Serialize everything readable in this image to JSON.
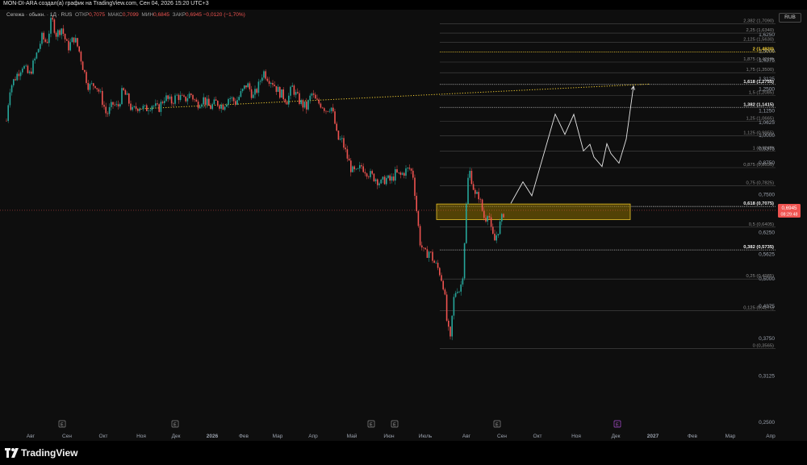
{
  "header": {
    "text": "MON-DI-ARA создал(а) график на TradingView.com, Сен 04, 2026 15:20 UTC+3"
  },
  "legend": {
    "symbol": "Сегежа · обыкн. · 1Д · RUS",
    "open_label": "ОТКР",
    "open_value": "0,7075",
    "high_label": "МАКС",
    "high_value": "0,7099",
    "low_label": "МИН",
    "low_value": "0,6845",
    "close_label": "ЗАКР",
    "close_value": "0,6945 −0,0120 (−1,70%)"
  },
  "currency": "RUB",
  "footer": {
    "brand": "TradingView"
  },
  "colors": {
    "up": "#26a69a",
    "down": "#ef5350",
    "fib_gold": "#f5d033",
    "zone_fill": "#8a6d00",
    "zone_border": "#e8c22a",
    "price_tag": "#ef5350"
  },
  "chart_data": {
    "type": "candlestick",
    "y_scale": "log",
    "ylim": [
      0.24,
      1.83
    ],
    "y_ticks": [
      {
        "value": 1.625,
        "label": "1,6250"
      },
      {
        "value": 1.5,
        "label": "1,5000"
      },
      {
        "value": 1.4375,
        "label": "1,4375"
      },
      {
        "value": 1.3125,
        "label": "1,3125"
      },
      {
        "value": 1.25,
        "label": "1,2500"
      },
      {
        "value": 1.125,
        "label": "1,1250"
      },
      {
        "value": 1.0625,
        "label": "1,0625"
      },
      {
        "value": 1.0,
        "label": "1,0000"
      },
      {
        "value": 0.9375,
        "label": "0,9375"
      },
      {
        "value": 0.875,
        "label": "0,8750"
      },
      {
        "value": 0.75,
        "label": "0,7500"
      },
      {
        "value": 0.625,
        "label": "0,6250"
      },
      {
        "value": 0.5625,
        "label": "0,5625"
      },
      {
        "value": 0.5,
        "label": "0,5000"
      },
      {
        "value": 0.4375,
        "label": "0,4375"
      },
      {
        "value": 0.375,
        "label": "0,3750"
      },
      {
        "value": 0.3125,
        "label": "0,3125"
      },
      {
        "value": 0.25,
        "label": "0,2500"
      }
    ],
    "x_ticks": [
      "Авг",
      "Сен",
      "Окт",
      "Ноя",
      "Дек",
      "2026",
      "Фев",
      "Мар",
      "Апр",
      "Май",
      "Июн",
      "Июль",
      "Авг",
      "Сен",
      "Окт",
      "Ноя",
      "Дек",
      "2027",
      "Фев",
      "Мар",
      "Апр"
    ],
    "fib_levels": [
      {
        "value": 1.709,
        "label": "2,382 (1,7090)",
        "style": "gray"
      },
      {
        "value": 1.634,
        "label": "2,25 (1,6340)",
        "style": "gray"
      },
      {
        "value": 1.563,
        "label": "2,125 (1,5630)",
        "style": "gray"
      },
      {
        "value": 1.492,
        "label": "2 (1,4920)",
        "style": "gold"
      },
      {
        "value": 1.421,
        "label": "1,875 (1,4210)",
        "style": "gray"
      },
      {
        "value": 1.35,
        "label": "1,75 (1,3500)",
        "style": "gray"
      },
      {
        "value": 1.2755,
        "label": "1,618 (1,2755)",
        "style": "white"
      },
      {
        "value": 1.2085,
        "label": "1,5 (1,2085)",
        "style": "gray"
      },
      {
        "value": 1.1415,
        "label": "1,382 (1,1415)",
        "style": "white"
      },
      {
        "value": 1.0665,
        "label": "1,25 (1,0665)",
        "style": "gray"
      },
      {
        "value": 0.9955,
        "label": "1,125 (0,9955)",
        "style": "gray"
      },
      {
        "value": 0.9245,
        "label": "1 (0,9245)",
        "style": "gray"
      },
      {
        "value": 0.8535,
        "label": "0,875 (0,8535)",
        "style": "gray"
      },
      {
        "value": 0.7825,
        "label": "0,75 (0,7825)",
        "style": "gray"
      },
      {
        "value": 0.7075,
        "label": "0,618 (0,7075)",
        "style": "white"
      },
      {
        "value": 0.6405,
        "label": "0,5 (0,6405)",
        "style": "gray"
      },
      {
        "value": 0.5735,
        "label": "0,382 (0,5735)",
        "style": "white"
      },
      {
        "value": 0.4985,
        "label": "0,25 (0,4985)",
        "style": "gray"
      },
      {
        "value": 0.4275,
        "label": "0,125 (0,4275)",
        "style": "gray"
      },
      {
        "value": 0.3565,
        "label": "0 (0,3565)",
        "style": "gray"
      }
    ],
    "last_price": "0,6945",
    "countdown": "08:29:48",
    "earnings_markers": [
      "E",
      "E",
      "E",
      "E",
      "E",
      "E"
    ],
    "zone": {
      "low": 0.664,
      "high": 0.716
    },
    "dotted_trend": [
      {
        "x": 170,
        "y": 1.133
      },
      {
        "x": 806,
        "y": 1.278
      }
    ],
    "projection": [
      {
        "x": 633,
        "y": 0.718
      },
      {
        "x": 648,
        "y": 0.797
      },
      {
        "x": 659,
        "y": 0.745
      },
      {
        "x": 688,
        "y": 1.105
      },
      {
        "x": 700,
        "y": 1.002
      },
      {
        "x": 711,
        "y": 1.104
      },
      {
        "x": 723,
        "y": 0.925
      },
      {
        "x": 731,
        "y": 0.955
      },
      {
        "x": 736,
        "y": 0.898
      },
      {
        "x": 746,
        "y": 0.858
      },
      {
        "x": 752,
        "y": 0.958
      },
      {
        "x": 757,
        "y": 0.914
      },
      {
        "x": 767,
        "y": 0.872
      },
      {
        "x": 776,
        "y": 0.98
      },
      {
        "x": 785,
        "y": 1.265
      }
    ],
    "price_path": [
      {
        "x": 8,
        "y": 1.07
      },
      {
        "x": 12,
        "y": 1.25
      },
      {
        "x": 18,
        "y": 1.31
      },
      {
        "x": 28,
        "y": 1.4
      },
      {
        "x": 36,
        "y": 1.33
      },
      {
        "x": 44,
        "y": 1.45
      },
      {
        "x": 52,
        "y": 1.6
      },
      {
        "x": 58,
        "y": 1.56
      },
      {
        "x": 64,
        "y": 1.75
      },
      {
        "x": 70,
        "y": 1.62
      },
      {
        "x": 76,
        "y": 1.68
      },
      {
        "x": 84,
        "y": 1.52
      },
      {
        "x": 92,
        "y": 1.6
      },
      {
        "x": 98,
        "y": 1.5
      },
      {
        "x": 104,
        "y": 1.36
      },
      {
        "x": 110,
        "y": 1.26
      },
      {
        "x": 118,
        "y": 1.28
      },
      {
        "x": 124,
        "y": 1.22
      },
      {
        "x": 132,
        "y": 1.1
      },
      {
        "x": 140,
        "y": 1.16
      },
      {
        "x": 146,
        "y": 1.14
      },
      {
        "x": 152,
        "y": 1.24
      },
      {
        "x": 158,
        "y": 1.19
      },
      {
        "x": 164,
        "y": 1.12
      },
      {
        "x": 172,
        "y": 1.15
      },
      {
        "x": 180,
        "y": 1.13
      },
      {
        "x": 188,
        "y": 1.16
      },
      {
        "x": 196,
        "y": 1.13
      },
      {
        "x": 204,
        "y": 1.2
      },
      {
        "x": 212,
        "y": 1.17
      },
      {
        "x": 220,
        "y": 1.21
      },
      {
        "x": 228,
        "y": 1.18
      },
      {
        "x": 236,
        "y": 1.22
      },
      {
        "x": 244,
        "y": 1.16
      },
      {
        "x": 252,
        "y": 1.19
      },
      {
        "x": 260,
        "y": 1.14
      },
      {
        "x": 268,
        "y": 1.17
      },
      {
        "x": 276,
        "y": 1.15
      },
      {
        "x": 284,
        "y": 1.2
      },
      {
        "x": 292,
        "y": 1.17
      },
      {
        "x": 300,
        "y": 1.23
      },
      {
        "x": 306,
        "y": 1.28
      },
      {
        "x": 314,
        "y": 1.2
      },
      {
        "x": 320,
        "y": 1.26
      },
      {
        "x": 326,
        "y": 1.36
      },
      {
        "x": 332,
        "y": 1.32
      },
      {
        "x": 338,
        "y": 1.29
      },
      {
        "x": 344,
        "y": 1.24
      },
      {
        "x": 350,
        "y": 1.21
      },
      {
        "x": 356,
        "y": 1.18
      },
      {
        "x": 362,
        "y": 1.26
      },
      {
        "x": 368,
        "y": 1.2
      },
      {
        "x": 374,
        "y": 1.16
      },
      {
        "x": 380,
        "y": 1.14
      },
      {
        "x": 386,
        "y": 1.22
      },
      {
        "x": 392,
        "y": 1.17
      },
      {
        "x": 398,
        "y": 1.16
      },
      {
        "x": 404,
        "y": 1.13
      },
      {
        "x": 410,
        "y": 1.15
      },
      {
        "x": 414,
        "y": 1.08
      },
      {
        "x": 418,
        "y": 0.98
      },
      {
        "x": 424,
        "y": 0.97
      },
      {
        "x": 430,
        "y": 0.9
      },
      {
        "x": 436,
        "y": 0.84
      },
      {
        "x": 442,
        "y": 0.83
      },
      {
        "x": 448,
        "y": 0.86
      },
      {
        "x": 454,
        "y": 0.84
      },
      {
        "x": 460,
        "y": 0.82
      },
      {
        "x": 466,
        "y": 0.81
      },
      {
        "x": 472,
        "y": 0.79
      },
      {
        "x": 478,
        "y": 0.81
      },
      {
        "x": 484,
        "y": 0.8
      },
      {
        "x": 490,
        "y": 0.83
      },
      {
        "x": 496,
        "y": 0.82
      },
      {
        "x": 502,
        "y": 0.84
      },
      {
        "x": 508,
        "y": 0.85
      },
      {
        "x": 512,
        "y": 0.82
      },
      {
        "x": 516,
        "y": 0.7
      },
      {
        "x": 520,
        "y": 0.6
      },
      {
        "x": 526,
        "y": 0.56
      },
      {
        "x": 532,
        "y": 0.57
      },
      {
        "x": 538,
        "y": 0.54
      },
      {
        "x": 544,
        "y": 0.52
      },
      {
        "x": 550,
        "y": 0.48
      },
      {
        "x": 554,
        "y": 0.4
      },
      {
        "x": 558,
        "y": 0.37
      },
      {
        "x": 562,
        "y": 0.45
      },
      {
        "x": 566,
        "y": 0.48
      },
      {
        "x": 570,
        "y": 0.47
      },
      {
        "x": 574,
        "y": 0.52
      },
      {
        "x": 578,
        "y": 0.72
      },
      {
        "x": 581,
        "y": 0.85
      },
      {
        "x": 585,
        "y": 0.8
      },
      {
        "x": 589,
        "y": 0.74
      },
      {
        "x": 593,
        "y": 0.75
      },
      {
        "x": 597,
        "y": 0.7
      },
      {
        "x": 601,
        "y": 0.66
      },
      {
        "x": 605,
        "y": 0.7
      },
      {
        "x": 609,
        "y": 0.62
      },
      {
        "x": 613,
        "y": 0.6
      },
      {
        "x": 617,
        "y": 0.63
      },
      {
        "x": 621,
        "y": 0.66
      },
      {
        "x": 625,
        "y": 0.6945
      }
    ]
  }
}
